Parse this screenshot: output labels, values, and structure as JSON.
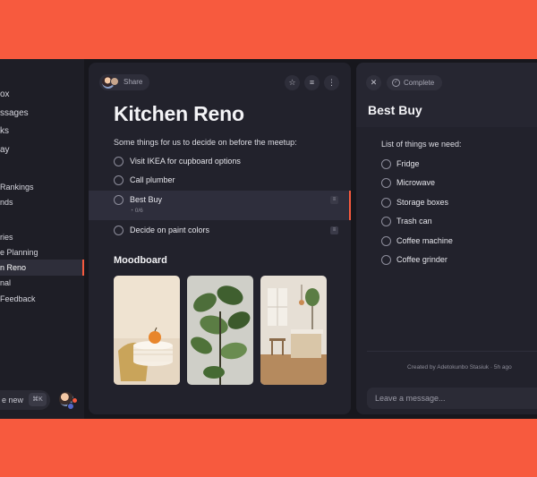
{
  "sidebar": {
    "items": [
      {
        "label": "ox",
        "size": "big"
      },
      {
        "label": "ssages",
        "size": "big"
      },
      {
        "label": "ks",
        "size": "big"
      },
      {
        "label": "ay",
        "size": "big"
      },
      {
        "label": "Rankings",
        "size": "small"
      },
      {
        "label": "nds",
        "size": "small"
      },
      {
        "label": "ries",
        "size": "small"
      },
      {
        "label": "e Planning",
        "size": "small"
      },
      {
        "label": "n Reno",
        "size": "small",
        "active": true
      },
      {
        "label": "nal",
        "size": "small"
      },
      {
        "label": "Feedback",
        "size": "small"
      }
    ],
    "new_label": "e new",
    "shortcut": "⌘K"
  },
  "main": {
    "share_label": "Share",
    "title": "Kitchen Reno",
    "subtitle": "Some things for us to decide on before the meetup:",
    "tasks": [
      {
        "label": "Visit IKEA for cupboard options"
      },
      {
        "label": "Call plumber"
      },
      {
        "label": "Best Buy",
        "sub": "0/6",
        "selected": true
      },
      {
        "label": "Decide on paint colors"
      }
    ],
    "moodboard_title": "Moodboard"
  },
  "detail": {
    "complete_label": "Complete",
    "title": "Best Buy",
    "subtitle": "List of things we need:",
    "items": [
      "Fridge",
      "Microwave",
      "Storage boxes",
      "Trash can",
      "Coffee machine",
      "Coffee grinder"
    ],
    "created": "Created by Adetokunbo Stasiuk · 5h ago",
    "message_placeholder": "Leave a message..."
  },
  "colors": {
    "background": "#f75a3e",
    "panel": "#22222c",
    "accent": "#f75a3e"
  }
}
